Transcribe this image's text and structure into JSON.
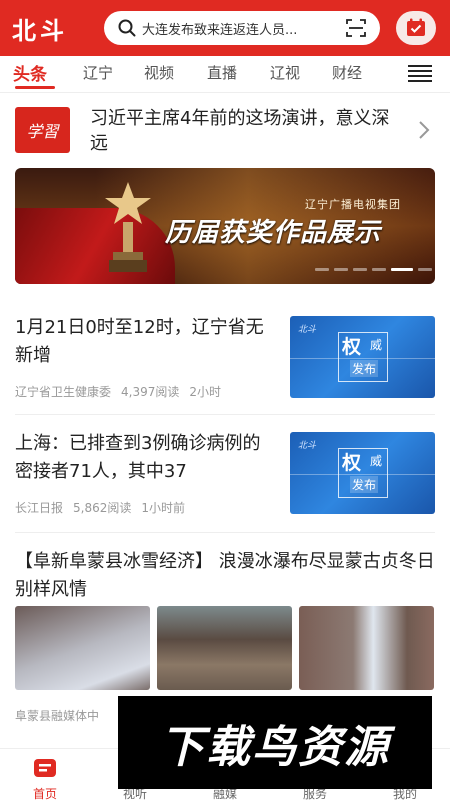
{
  "header": {
    "logo": "北斗",
    "search_text": "大连发布致来连返连人员...",
    "brand_color": "#e02a22"
  },
  "tabs": [
    {
      "label": "头条",
      "active": true
    },
    {
      "label": "辽宁"
    },
    {
      "label": "视频"
    },
    {
      "label": "直播"
    },
    {
      "label": "辽视"
    },
    {
      "label": "财经"
    }
  ],
  "study": {
    "logo_text": "学習",
    "title": "习近平主席4年前的这场演讲，意义深远"
  },
  "banner": {
    "small": "辽宁广播电视集团",
    "title": "历届获奖作品展示",
    "dot_count": 7,
    "active_dot": 5
  },
  "news": [
    {
      "title": "1月21日0时至12时，辽宁省无新增",
      "source": "辽宁省卫生健康委",
      "reads": "4,397阅读",
      "time": "2小时",
      "thumb": {
        "tag": "北斗",
        "t1": "权",
        "t2": "威",
        "t3": "发布"
      }
    },
    {
      "title": "上海：已排查到3例确诊病例的密接者71人，其中37",
      "source": "长江日报",
      "reads": "5,862阅读",
      "time": "1小时前",
      "thumb": {
        "tag": "北斗",
        "t1": "权",
        "t2": "威",
        "t3": "发布"
      }
    }
  ],
  "photo_article": {
    "title": "【阜新阜蒙县冰雪经济】 浪漫冰瀑布尽显蒙古贞冬日别样风情",
    "source": "阜蒙县融媒体中"
  },
  "bottom_nav": [
    {
      "label": "首页",
      "active": true,
      "icon": "home-icon"
    },
    {
      "label": "视听",
      "icon": "video-icon"
    },
    {
      "label": "融媒",
      "icon": "media-icon"
    },
    {
      "label": "服务",
      "icon": "service-icon"
    },
    {
      "label": "我的",
      "icon": "user-icon"
    }
  ],
  "watermark": {
    "text": "下载鸟资源"
  }
}
